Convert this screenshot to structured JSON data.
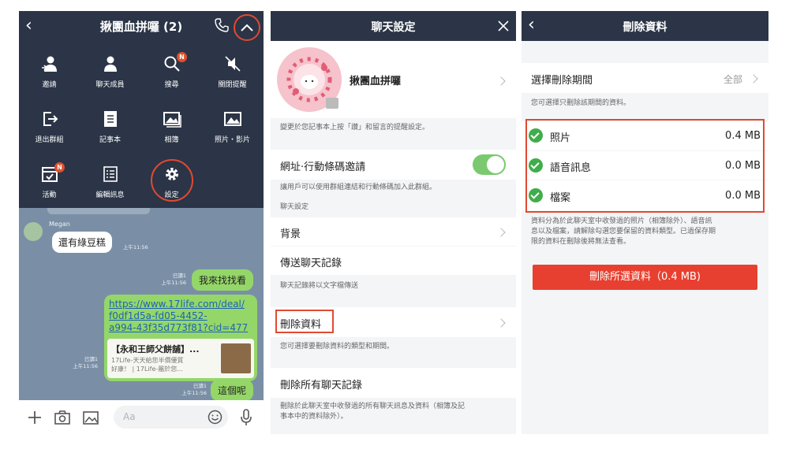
{
  "colors": {
    "header": "#2b3547",
    "accent_red": "#e84030",
    "green_bubble": "#94d768",
    "toggle_green": "#7bc96f",
    "check_green": "#3fae4a"
  },
  "panel1": {
    "title": "揪團血拼囉 (2)",
    "menu": [
      {
        "label": "邀請",
        "icon": "invite-icon"
      },
      {
        "label": "聊天成員",
        "icon": "members-icon"
      },
      {
        "label": "搜尋",
        "icon": "search-icon",
        "badge": "N"
      },
      {
        "label": "關閉提醒",
        "icon": "mute-icon"
      },
      {
        "label": "退出群組",
        "icon": "leave-icon"
      },
      {
        "label": "記事本",
        "icon": "note-icon"
      },
      {
        "label": "相簿",
        "icon": "album-icon"
      },
      {
        "label": "照片・影片",
        "icon": "photo-icon"
      },
      {
        "label": "活動",
        "icon": "event-icon",
        "badge": "N"
      },
      {
        "label": "編輯訊息",
        "icon": "edit-icon"
      },
      {
        "label": "設定",
        "icon": "settings-icon"
      }
    ],
    "chat": {
      "sender": "Megan",
      "msg1": "還有綠豆糕",
      "msg1_time": "上午11:56",
      "read1": "已讀1",
      "time2": "上午11:56",
      "msg2": "我來找找看",
      "link_lines": [
        "https://www.17life.com/deal/",
        "f0df1d5a-fd05-4452-",
        "a994-43f35d773f81?cid=477"
      ],
      "card_title": "【永和王師父餅舖】...",
      "card_desc1": "17Life-天天給您半價優質",
      "card_desc2": "好康！ | 17Life-屬於您...",
      "read3": "已讀1",
      "time3": "上午11:56",
      "read4": "已讀1",
      "time4": "上午11:56",
      "msg4": "這個呢"
    },
    "input_placeholder": "Aa"
  },
  "panel2": {
    "title": "聊天設定",
    "group_name": "揪團血拼囉",
    "note1": "變更於您記事本上按「讚」和留言的提醒設定。",
    "invite_row": "網址·行動條碼邀請",
    "note2": "讓用戶可以使用群組連結和行動條碼加入此群組。",
    "section": "聊天設定",
    "bg_row": "背景",
    "send_history_row": "傳送聊天記錄",
    "note3": "聊天記錄將以文字檔傳送",
    "delete_data_row": "刪除資料",
    "note4": "您可選擇要刪除資料的類型和期間。",
    "delete_all_row": "刪除所有聊天記錄",
    "note5a": "刪除於此聊天室中收發過的所有聊天訊息及資料（相簿及記",
    "note5b": "事本中的資料除外）。"
  },
  "panel3": {
    "title": "刪除資料",
    "period_label": "選擇刪除期間",
    "period_value": "全部",
    "period_note": "您可選擇只刪除該期間的資料。",
    "items": [
      {
        "label": "照片",
        "size": "0.4 MB",
        "checked": true
      },
      {
        "label": "語音訊息",
        "size": "0.0 MB",
        "checked": true
      },
      {
        "label": "檔案",
        "size": "0.0 MB",
        "checked": true
      }
    ],
    "desc1": "資料分為於此聊天室中收發過的照片（相簿除外）、語音訊",
    "desc2": "息以及檔案，請解除勾選您要保留的資料類型。已過保存期",
    "desc3": "限的資料在刪除後將無法查看。",
    "button": "刪除所選資料（0.4 MB)"
  }
}
